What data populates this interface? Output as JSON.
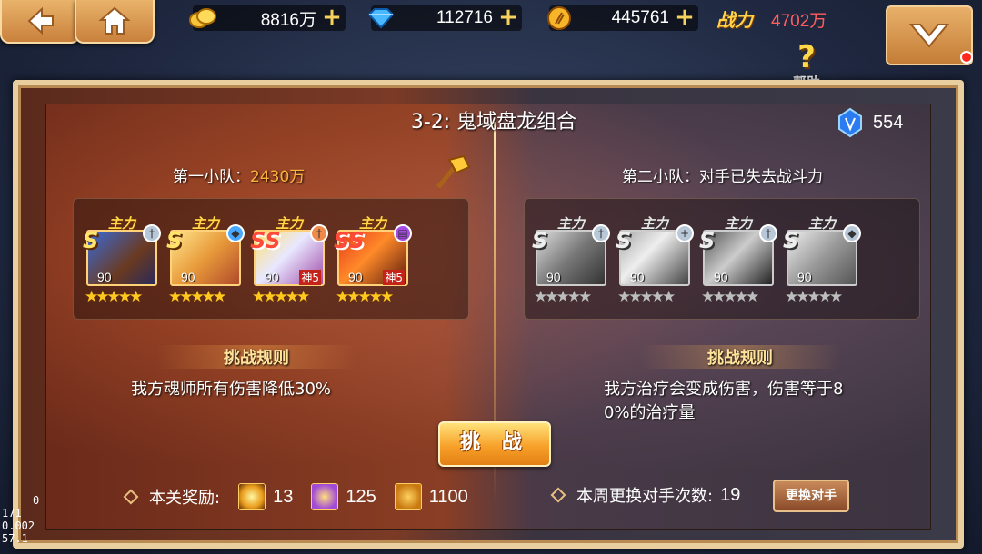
{
  "topbar": {
    "gold": "8816万",
    "diamond": "112716",
    "coin": "445761",
    "power_label": "战力",
    "power_value": "4702万",
    "help_label": "帮助"
  },
  "panel": {
    "title": "3-2: 鬼域盘龙组合",
    "gem_count": "554",
    "team1": {
      "label": "第一小队：",
      "power": "2430万",
      "heroes": [
        {
          "main": "主力",
          "rank": "S",
          "level": "90",
          "stars": "★★★★★",
          "shen": ""
        },
        {
          "main": "主力",
          "rank": "S",
          "level": "90",
          "stars": "★★★★★",
          "shen": ""
        },
        {
          "main": "主力",
          "rank": "SS",
          "level": "90",
          "stars": "★★★★★",
          "shen": "神5"
        },
        {
          "main": "主力",
          "rank": "SS",
          "level": "90",
          "stars": "★★★★★",
          "shen": "神5"
        }
      ],
      "rule_title": "挑战规则",
      "rule_text": "我方魂师所有伤害降低30%"
    },
    "team2": {
      "label": "第二小队：对手已失去战斗力",
      "heroes": [
        {
          "main": "主力",
          "rank": "S",
          "level": "90",
          "stars": "★★★★★"
        },
        {
          "main": "主力",
          "rank": "S",
          "level": "90",
          "stars": "★★★★★"
        },
        {
          "main": "主力",
          "rank": "S",
          "level": "90",
          "stars": "★★★★★"
        },
        {
          "main": "主力",
          "rank": "S",
          "level": "90",
          "stars": "★★★★★"
        }
      ],
      "rule_title": "挑战规则",
      "rule_line1": "我方治疗会变成伤害，伤害等于8",
      "rule_line2": "0%的治疗量"
    },
    "challenge_label": "挑 战",
    "reward_label": "本关奖励:",
    "rewards": [
      "13",
      "125",
      "1100"
    ],
    "week_label": "本周更换对手次数:",
    "week_count": "19",
    "swap_label": "更换对手"
  },
  "debug": [
    "0",
    "171",
    "0.002",
    "57.1"
  ]
}
